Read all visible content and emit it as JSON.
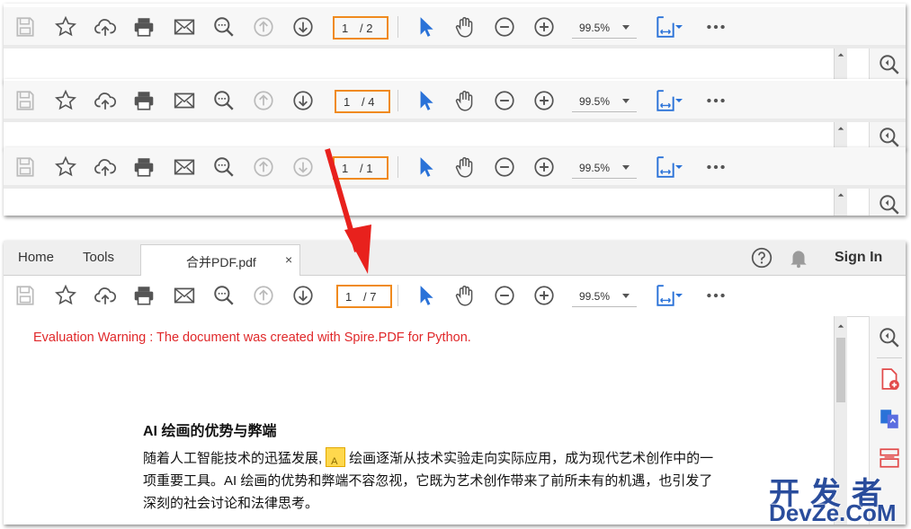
{
  "toolbars": [
    {
      "page_current": "1",
      "page_total": "/ 2",
      "zoom": "99.5%"
    },
    {
      "page_current": "1",
      "page_total": "/ 4",
      "zoom": "99.5%"
    },
    {
      "page_current": "1",
      "page_total": "/ 1",
      "zoom": "99.5%"
    }
  ],
  "viewer": {
    "tabs": {
      "home": "Home",
      "tools": "Tools"
    },
    "document_tab": {
      "name": "合并PDF.pdf",
      "close": "×"
    },
    "sign_in": "Sign In",
    "page_current": "1",
    "page_total": "/ 7",
    "zoom": "99.5%"
  },
  "document": {
    "warning": "Evaluation Warning : The document was created with Spire.PDF for Python.",
    "heading": "AI 绘画的优势与弊端",
    "para_part1": "随着人工智能技术的迅猛发展,",
    "inline_icon_label": "A",
    "para_part2": "绘画逐渐从技术实验走向实际应用，成为现代艺术创作中的一项重要工具。AI 绘画的优势和弊端不容忽视，它既为艺术创作带来了前所未有的机遇，也引发了深刻的社会讨论和法律思考。"
  },
  "watermark": {
    "line1": "开发者",
    "line2": "DevZe.CoM"
  },
  "colors": {
    "highlight_orange": "#f08a1e",
    "arrow_red": "#e8211d",
    "warning_red": "#e0282a",
    "icon_blue": "#2a72d8",
    "icon_gray": "#555555"
  },
  "icons": [
    "save-icon",
    "bookmark-star-icon",
    "cloud-upload-icon",
    "print-icon",
    "email-icon",
    "search-zoom-icon",
    "page-up-icon",
    "page-down-icon",
    "select-cursor-icon",
    "hand-pan-icon",
    "zoom-out-icon",
    "zoom-in-icon",
    "fit-page-icon",
    "more-icon",
    "help-icon",
    "bell-icon",
    "zoom-side-icon",
    "export-pdf-icon",
    "create-pdf-icon",
    "organize-pages-icon"
  ]
}
